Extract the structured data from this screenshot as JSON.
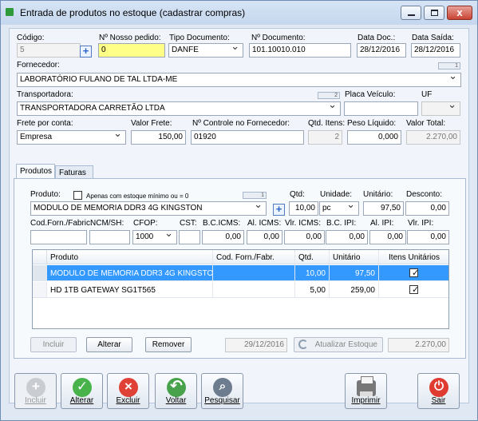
{
  "window": {
    "title": "Entrada de produtos no estoque (cadastrar compras)",
    "controls": {
      "minimize_icon": "minimize-icon",
      "maximize_icon": "maximize-icon",
      "close": "x"
    }
  },
  "header": {
    "codigo": {
      "label": "Código:",
      "value": "5"
    },
    "nosso_pedido": {
      "label": "Nº Nosso pedido:",
      "value": "0"
    },
    "tipo_documento": {
      "label": "Tipo Documento:",
      "value": "DANFE"
    },
    "numero_documento": {
      "label": "Nº Documento:",
      "value": "101.10010.010"
    },
    "data_doc": {
      "label": "Data Doc.:",
      "value": "28/12/2016"
    },
    "data_saida": {
      "label": "Data Saída:",
      "value": "28/12/2016"
    },
    "fornecedor": {
      "label": "Fornecedor:",
      "value": "LABORATÓRIO FULANO DE TAL LTDA-ME",
      "badge": "1"
    },
    "transportadora": {
      "label": "Transportadora:",
      "value": "TRANSPORTADORA CARRETÃO LTDA",
      "badge": "2"
    },
    "placa_veiculo": {
      "label": "Placa Veículo:",
      "value": ""
    },
    "uf": {
      "label": "UF",
      "value": ""
    },
    "frete_por_conta": {
      "label": "Frete por conta:",
      "value": "Empresa"
    },
    "valor_frete": {
      "label": "Valor Frete:",
      "value": "150,00"
    },
    "controle_fornecedor": {
      "label": "Nº Controle no Fornecedor:",
      "value": "01920"
    },
    "qtd_itens": {
      "label": "Qtd. Itens:",
      "value": "2"
    },
    "peso_liquido": {
      "label": "Peso Líquido:",
      "value": "0,000"
    },
    "valor_total": {
      "label": "Valor Total:",
      "value": "2.270,00"
    }
  },
  "tabs": [
    "Produtos",
    "Faturas"
  ],
  "produto": {
    "label": "Produto:",
    "min_stock_label": "Apenas com estoque mínimo ou = 0",
    "badge": "1",
    "selected": "MODULO DE MEMORIA DDR3 4G KINGSTON",
    "qtd": {
      "label": "Qtd:",
      "value": "10,00"
    },
    "unidade": {
      "label": "Unidade:",
      "value": "pc"
    },
    "unitario": {
      "label": "Unitário:",
      "value": "97,50"
    },
    "desconto": {
      "label": "Desconto:",
      "value": "0,00"
    },
    "cod_fabric": {
      "label": "Cod.Forn./Fabric.",
      "value": ""
    },
    "ncm_sh": {
      "label": "NCM/SH:",
      "value": ""
    },
    "cfop": {
      "label": "CFOP:",
      "value": "1000"
    },
    "cst": {
      "label": "CST:",
      "value": ""
    },
    "bc_icms": {
      "label": "B.C.ICMS:",
      "value": "0,00"
    },
    "al_icms": {
      "label": "Al. ICMS:",
      "value": "0,00"
    },
    "vlr_icms": {
      "label": "Vlr. ICMS:",
      "value": "0,00"
    },
    "bc_ipi": {
      "label": "B.C. IPI:",
      "value": "0,00"
    },
    "al_ipi": {
      "label": "Al. IPI:",
      "value": "0,00"
    },
    "vlr_ipi": {
      "label": "Vlr. IPI:",
      "value": "0,00"
    }
  },
  "grid": {
    "columns": [
      "Produto",
      "Cod. Forn./Fabr.",
      "Qtd.",
      "Unitário",
      "Itens Unitários"
    ],
    "rows": [
      {
        "produto": "MODULO DE MEMORIA DDR3 4G KINGSTON",
        "cod": "",
        "qtd": "10,00",
        "unitario": "97,50",
        "itens_unitarios": true
      },
      {
        "produto": "HD 1TB GATEWAY SG1T565",
        "cod": "",
        "qtd": "5,00",
        "unitario": "259,00",
        "itens_unitarios": true
      }
    ]
  },
  "grid_actions": {
    "incluir": "Incluir",
    "alterar": "Alterar",
    "remover": "Remover",
    "date": "29/12/2016",
    "atualizar_estoque": "Atualizar Estoque",
    "total": "2.270,00"
  },
  "toolbar": {
    "incluir": "Incluir",
    "alterar": "Alterar",
    "excluir": "Excluir",
    "voltar": "Voltar",
    "pesquisar": "Pesquisar",
    "imprimir": "Imprimir",
    "sair": "Sair"
  },
  "colors": {
    "accent": "#3399ff",
    "field_highlight": "#ffff88",
    "toolbar_bg": "#dfe8f3"
  }
}
